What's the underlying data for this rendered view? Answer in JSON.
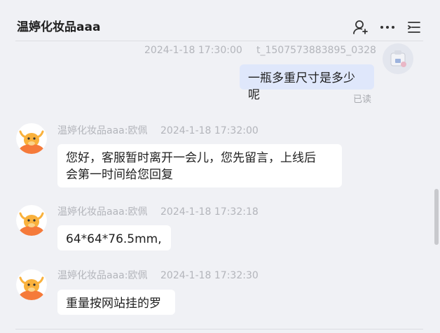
{
  "header": {
    "title": "温婷化妆品aaa"
  },
  "messages": [
    {
      "sender": "self",
      "time": "2024-1-18 17:30:00",
      "user": "t_1507573883895_0328",
      "text": "一瓶多重尺寸是多少呢",
      "status": "已读"
    },
    {
      "sender": "温婷化妆品aaa:欧佩",
      "time": "2024-1-18 17:32:00",
      "text": "您好，客服暂时离开一会儿，您先留言，上线后\n会第一时间给您回复"
    },
    {
      "sender": "温婷化妆品aaa:欧佩",
      "time": "2024-1-18 17:32:18",
      "text": "64*64*76.5mm,"
    },
    {
      "sender": "温婷化妆品aaa:欧佩",
      "time": "2024-1-18 17:32:30",
      "text": "重量按网站挂的罗"
    }
  ],
  "colors": {
    "background": "#f0f1f5",
    "self_bubble": "#dfe7fb",
    "other_bubble": "#ffffff",
    "meta_text": "#b3b5bb",
    "avatar_orange": "#f57a3a"
  },
  "icons": [
    "add-user-icon",
    "more-icon",
    "list-menu-icon",
    "bull-avatar-icon"
  ]
}
